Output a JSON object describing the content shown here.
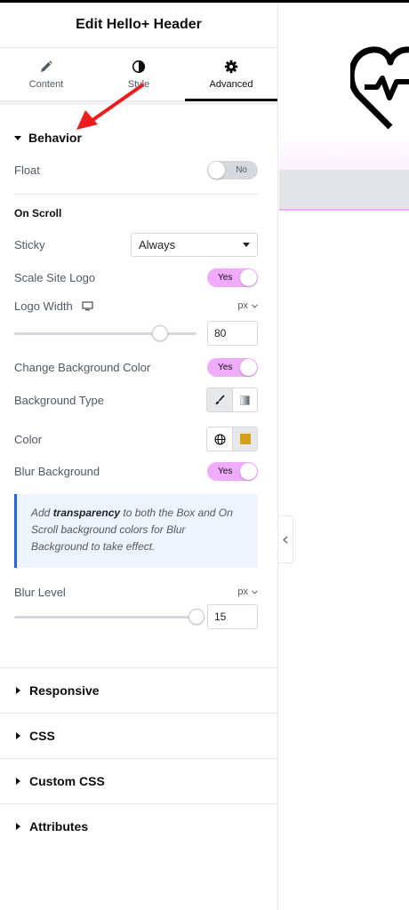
{
  "panel": {
    "title": "Edit Hello+ Header"
  },
  "tabs": [
    {
      "label": "Content",
      "icon": "pencil-icon"
    },
    {
      "label": "Style",
      "icon": "half-circle-icon"
    },
    {
      "label": "Advanced",
      "icon": "gear-icon"
    }
  ],
  "behavior": {
    "title": "Behavior",
    "float": {
      "label": "Float",
      "value": "No"
    },
    "on_scroll": "On Scroll",
    "sticky": {
      "label": "Sticky",
      "value": "Always"
    },
    "scale_logo": {
      "label": "Scale Site Logo",
      "value": "Yes"
    },
    "logo_width": {
      "label": "Logo Width",
      "unit": "px",
      "value": "80",
      "fraction": 0.8
    },
    "change_bg": {
      "label": "Change Background Color",
      "value": "Yes"
    },
    "bg_type": {
      "label": "Background Type"
    },
    "color": {
      "label": "Color",
      "swatch": "#d4a017"
    },
    "blur_bg": {
      "label": "Blur Background",
      "value": "Yes"
    },
    "note": {
      "before": "Add ",
      "bold": "transparency",
      "after": " to both the Box and On Scroll background colors for Blur Background to take effect."
    },
    "blur_level": {
      "label": "Blur Level",
      "unit": "px",
      "value": "15",
      "fraction": 1.0
    }
  },
  "collapsed_sections": [
    "Responsive",
    "CSS",
    "Custom CSS",
    "Attributes"
  ],
  "colors": {
    "accent_toggle": "#f0abfc",
    "note_border": "#2563eb",
    "annotation_arrow": "#ee1c1c"
  }
}
